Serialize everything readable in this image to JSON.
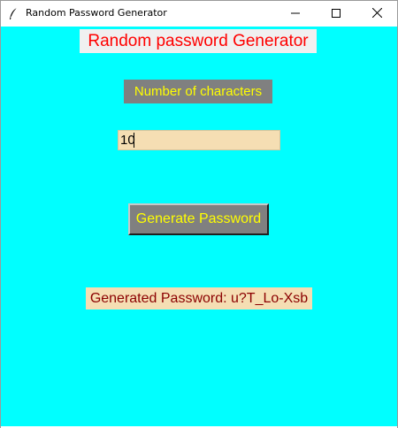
{
  "window": {
    "title": "Random Password Generator",
    "controls": [
      "minimize-icon",
      "maximize-icon",
      "close-icon"
    ],
    "app_icon": "feather-icon"
  },
  "form": {
    "heading": "Random password Generator",
    "length_label": "Number of characters",
    "length_value": "10",
    "generate_label": "Generate Password",
    "result_text": "Generated Password: u?T_Lo-Xsb"
  },
  "colors": {
    "background": "#00ffff",
    "heading_text": "#ff0000",
    "label_bg": "#808080",
    "label_text": "#ffff00",
    "entry_bg": "#f5deb3",
    "result_text": "#8b0000"
  }
}
